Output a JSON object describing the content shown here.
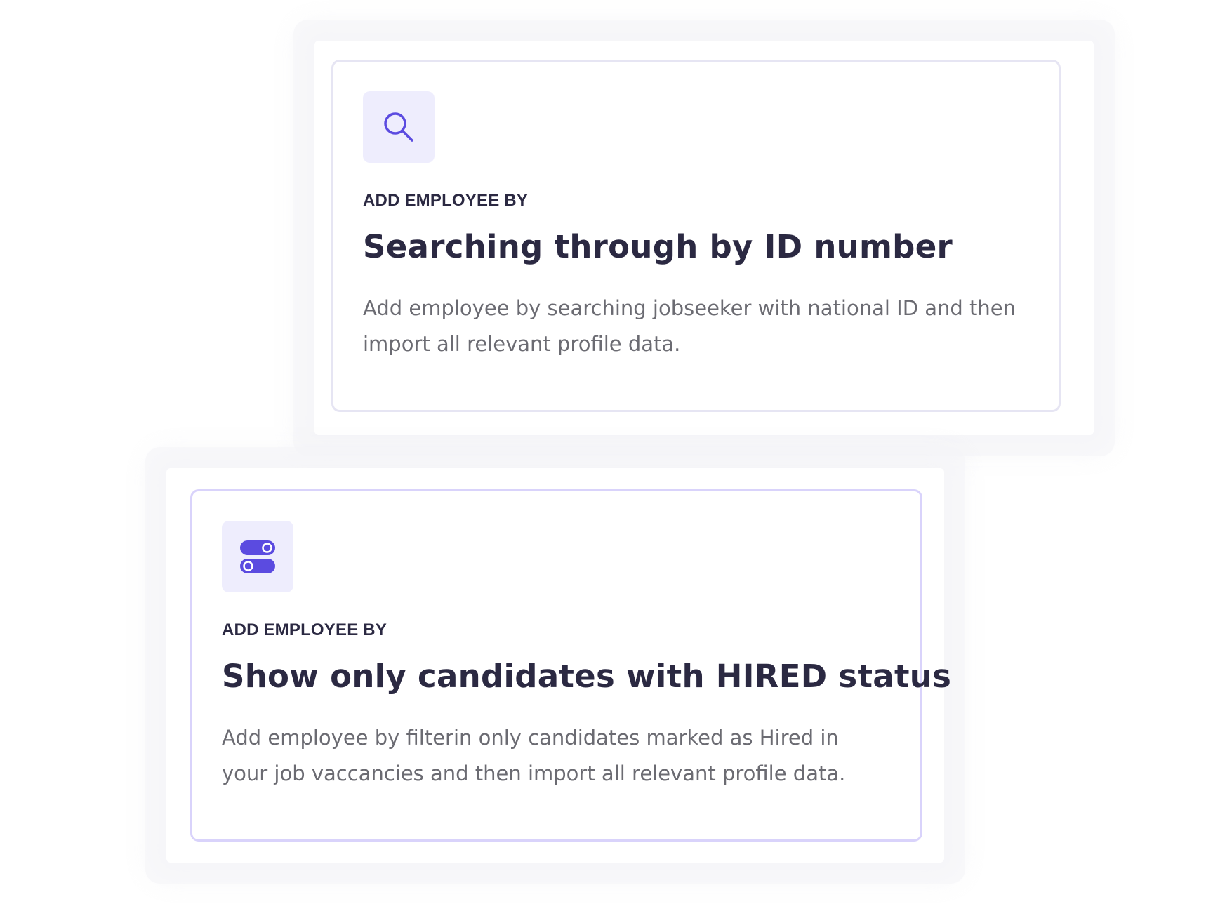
{
  "cards": [
    {
      "icon": "search-icon",
      "eyebrow": "ADD EMPLOYEE BY",
      "title": "Searching through by ID number",
      "description": "Add employee by searching jobseeker with national ID and then import all relevant profile data."
    },
    {
      "icon": "toggle-icon",
      "eyebrow": "ADD EMPLOYEE BY",
      "title": "Show only candidates with HIRED status",
      "description": "Add employee by filterin only candidates marked as Hired in your job vaccancies and then import all relevant profile data."
    }
  ],
  "colors": {
    "accent": "#5b4be0",
    "icon_bg": "#eeedfd",
    "heading": "#2b2942",
    "body_text": "#6b6b72",
    "card_border_default": "#e6e5f3",
    "card_border_selected": "#d9d3fb"
  }
}
